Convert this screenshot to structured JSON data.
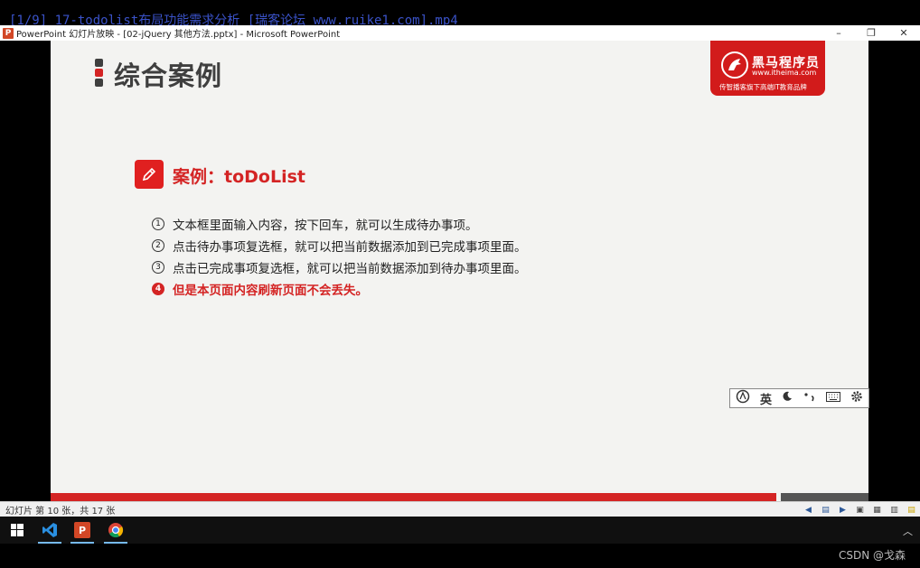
{
  "video_title": "[1/9] 17-todolist布局功能需求分析 [瑞客论坛 www.ruike1.com].mp4",
  "window": {
    "title": "PowerPoint 幻灯片放映 - [02-jQuery 其他方法.pptx] - Microsoft PowerPoint",
    "minimize": "–",
    "restore": "❐",
    "close": "✕"
  },
  "slide": {
    "title": "综合案例",
    "brand": {
      "name": "黑马程序员",
      "url": "www.itheima.com",
      "slogan": "传智播客旗下高端IT教育品牌"
    },
    "case_title": "案例：toDoList",
    "items": [
      {
        "num": "1",
        "text": "文本框里面输入内容，按下回车，就可以生成待办事项。"
      },
      {
        "num": "2",
        "text": "点击待办事项复选框，就可以把当前数据添加到已完成事项里面。"
      },
      {
        "num": "3",
        "text": "点击已完成事项复选框，就可以把当前数据添加到待办事项里面。"
      },
      {
        "num": "4",
        "text": "但是本页面内容刷新页面不会丢失。"
      }
    ],
    "marker_colors": [
      "#3f3f3f",
      "#d42424",
      "#3f3f3f"
    ]
  },
  "ime": {
    "lang": "英"
  },
  "statusbar": {
    "text": "幻灯片 第 10 张，共 17 张"
  },
  "watermark": "CSDN @戈森",
  "colors": {
    "accent_red": "#d42424",
    "brand_red": "#d21b1b"
  }
}
